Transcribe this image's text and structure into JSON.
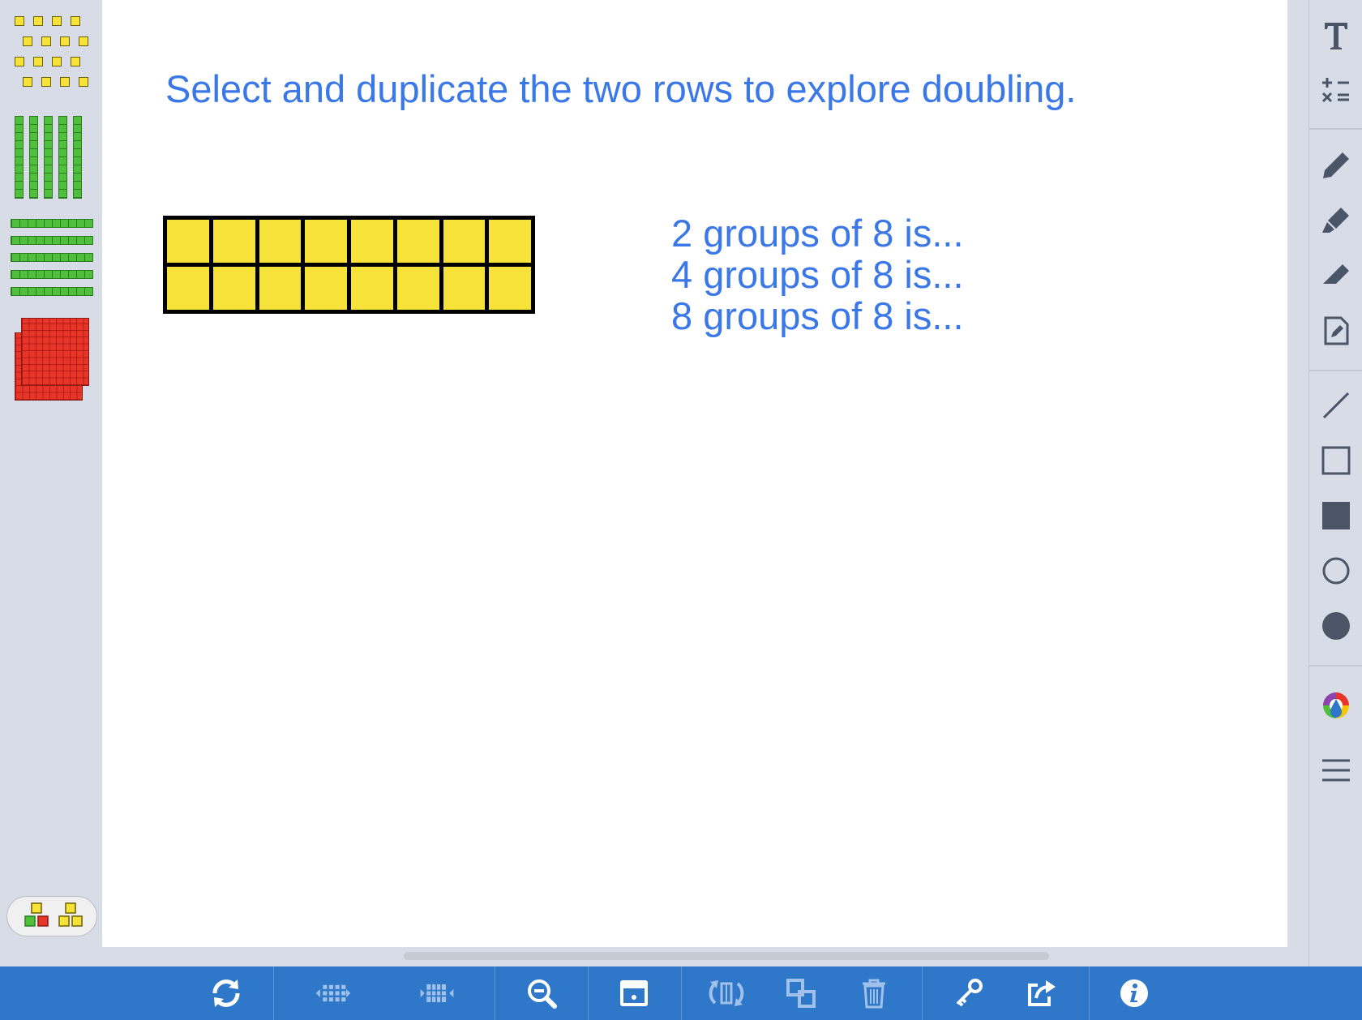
{
  "canvas": {
    "instruction": "Select and duplicate the two rows to explore doubling.",
    "groups": [
      "2 groups of 8 is...",
      "4 groups of 8 is...",
      "8 groups of 8 is..."
    ],
    "tile_grid": {
      "rows": 2,
      "columns": 8,
      "color": "#f7e23a"
    }
  },
  "left_palette": {
    "items": [
      "units",
      "rods-vertical",
      "rods-horizontal",
      "flats"
    ],
    "colors": {
      "unit": "#f7e23a",
      "rod": "#4fbf3c",
      "flat": "#e8352a"
    },
    "mode_toggle": [
      "colored-blocks",
      "yellow-blocks"
    ]
  },
  "right_toolbar": {
    "icons": [
      "text-icon",
      "expression-icon",
      "pencil-icon",
      "highlighter-icon",
      "eraser-icon",
      "note-icon",
      "line-icon",
      "rectangle-outline-icon",
      "rectangle-filled-icon",
      "circle-outline-icon",
      "circle-filled-icon",
      "color-picker-icon",
      "menu-icon"
    ]
  },
  "bottom_toolbar": {
    "icons": [
      "refresh-icon",
      "grid-shrink-icon",
      "grid-expand-icon",
      "zoom-out-icon",
      "screen-icon",
      "flip-icon",
      "duplicate-icon",
      "trash-icon",
      "key-icon",
      "share-icon",
      "info-icon"
    ]
  },
  "colors": {
    "accent": "#3b78e7",
    "toolbar": "#2f77c8",
    "panel": "#d7dce6"
  }
}
